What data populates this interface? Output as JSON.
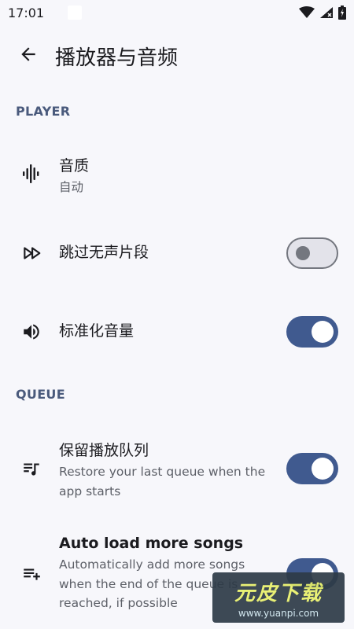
{
  "status_bar": {
    "time": "17:01",
    "icons": [
      "wifi-icon",
      "signal-no-data-icon",
      "battery-charging-icon"
    ]
  },
  "app_bar": {
    "back_icon": "arrow-back-icon",
    "title": "播放器与音频"
  },
  "sections": {
    "player": {
      "header": "PLAYER",
      "items": [
        {
          "icon": "audio-waveform-icon",
          "title": "音质",
          "subtitle": "自动"
        },
        {
          "icon": "fast-forward-icon",
          "title": "跳过无声片段",
          "toggle": false
        },
        {
          "icon": "volume-icon",
          "title": "标准化音量",
          "toggle": true
        }
      ]
    },
    "queue": {
      "header": "QUEUE",
      "items": [
        {
          "icon": "queue-music-icon",
          "title": "保留播放队列",
          "subtitle_line1": "Restore your last queue when the",
          "subtitle_line2": "app starts",
          "toggle": true
        },
        {
          "icon": "playlist-add-icon",
          "title": "Auto load more songs",
          "subtitle_line1": "Automatically add more songs",
          "subtitle_line2": "when the end of the queue is",
          "subtitle_line3": "reached, if possible",
          "toggle": true
        }
      ]
    }
  },
  "watermark": {
    "logo": "元皮下载",
    "url": "www.yuanpi.com"
  },
  "colors": {
    "accent": "#405a8f",
    "section_header": "#4a5a7c",
    "background": "#f7f7fb"
  }
}
